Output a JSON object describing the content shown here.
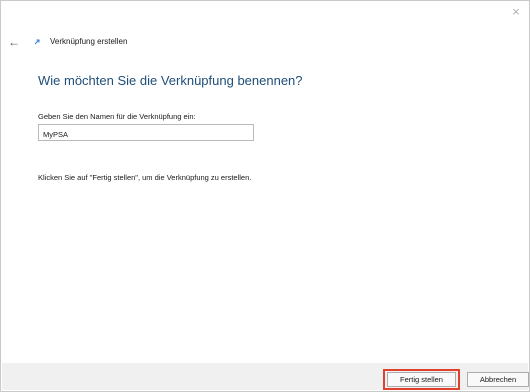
{
  "window": {
    "title": "Verknüpfung erstellen",
    "close_glyph": "×",
    "back_glyph": "←"
  },
  "content": {
    "heading": "Wie möchten Sie die Verknüpfung benennen?",
    "prompt": "Geben Sie den Namen für die Verknüpfung ein:",
    "name_value": "MyPSA",
    "instruction": "Klicken Sie auf \"Fertig stellen\", um die Verknüpfung zu erstellen."
  },
  "buttons": {
    "finish": "Fertig stellen",
    "cancel": "Abbrechen"
  },
  "colors": {
    "heading": "#1f4e79",
    "highlight": "#e0402e"
  }
}
